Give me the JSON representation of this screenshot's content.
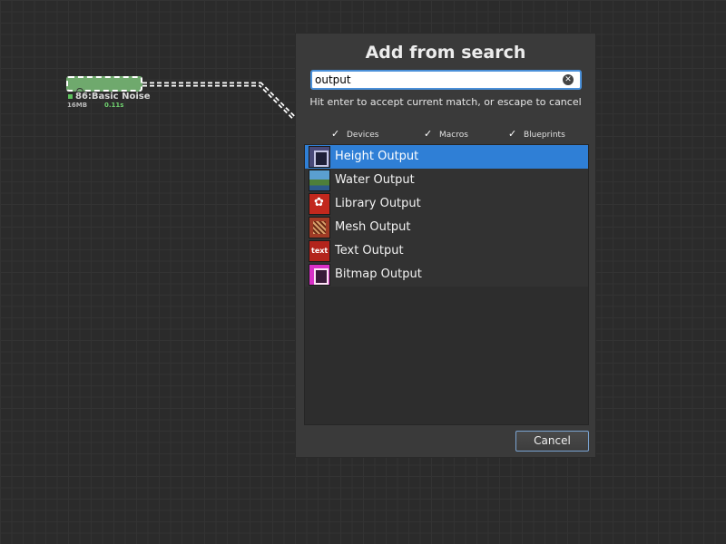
{
  "node": {
    "title": "86:Basic Noise",
    "memory": "16MB",
    "time": "0.11s"
  },
  "dialog": {
    "title": "Add from search",
    "search_value": "output",
    "clear_icon": "clear-x-icon",
    "hint": "Hit enter to accept current match, or escape to cancel",
    "filters": [
      {
        "label": "Devices",
        "checked": true
      },
      {
        "label": "Macros",
        "checked": true
      },
      {
        "label": "Blueprints",
        "checked": true
      }
    ],
    "check_glyph": "✓",
    "results": [
      {
        "label": "Height Output",
        "icon": "height-output-icon",
        "selected": true
      },
      {
        "label": "Water Output",
        "icon": "water-output-icon",
        "selected": false
      },
      {
        "label": "Library Output",
        "icon": "library-output-icon",
        "selected": false
      },
      {
        "label": "Mesh Output",
        "icon": "mesh-output-icon",
        "selected": false
      },
      {
        "label": "Text Output",
        "icon": "text-output-icon",
        "selected": false
      },
      {
        "label": "Bitmap Output",
        "icon": "bitmap-output-icon",
        "selected": false
      }
    ],
    "cancel_label": "Cancel"
  },
  "colors": {
    "selection": "#2f7fd6",
    "node_fill": "#6fa96d",
    "focus_border": "#4a90d9"
  }
}
